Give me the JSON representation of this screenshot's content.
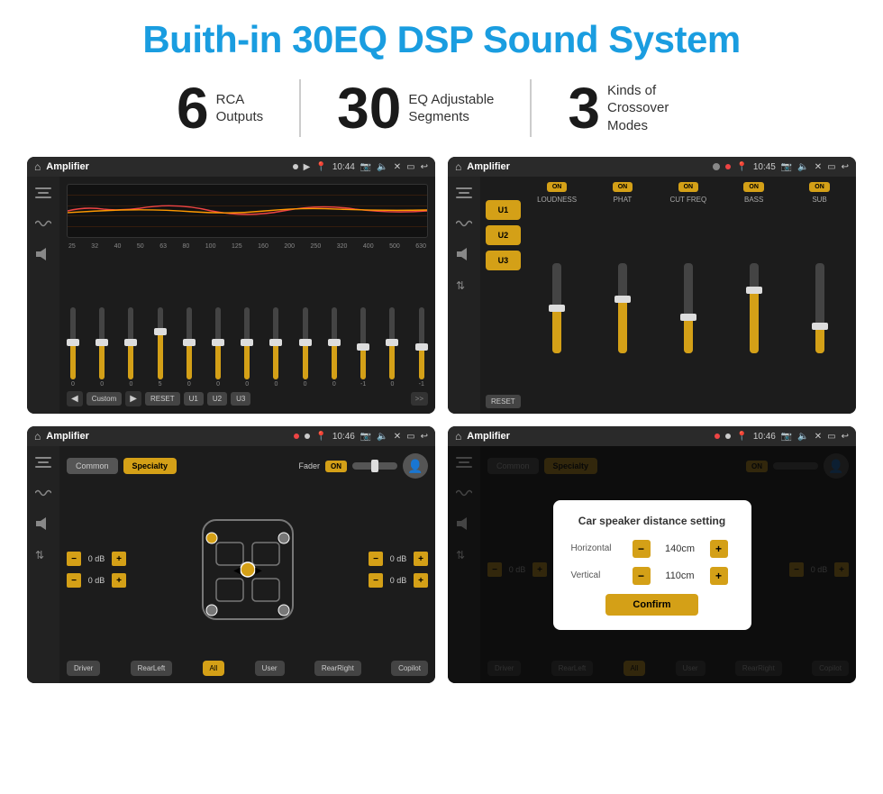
{
  "header": {
    "title": "Buith-in 30EQ DSP Sound System"
  },
  "stats": [
    {
      "number": "6",
      "text": "RCA\nOutputs"
    },
    {
      "number": "30",
      "text": "EQ Adjustable\nSegments"
    },
    {
      "number": "3",
      "text": "Kinds of\nCrossover Modes"
    }
  ],
  "screens": {
    "eq": {
      "statusBar": {
        "appName": "Amplifier",
        "time": "10:44"
      },
      "freqLabels": [
        "25",
        "32",
        "40",
        "50",
        "63",
        "80",
        "100",
        "125",
        "160",
        "200",
        "250",
        "320",
        "400",
        "500",
        "630"
      ],
      "sliderValues": [
        "0",
        "0",
        "0",
        "5",
        "0",
        "0",
        "0",
        "0",
        "0",
        "0",
        "-1",
        "0",
        "-1"
      ],
      "buttons": [
        "Custom",
        "RESET",
        "U1",
        "U2",
        "U3"
      ]
    },
    "crossover": {
      "statusBar": {
        "appName": "Amplifier",
        "time": "10:45"
      },
      "presets": [
        "U1",
        "U2",
        "U3"
      ],
      "channels": [
        {
          "label": "LOUDNESS",
          "on": true
        },
        {
          "label": "PHAT",
          "on": true
        },
        {
          "label": "CUT FREQ",
          "on": true
        },
        {
          "label": "BASS",
          "on": true
        },
        {
          "label": "SUB",
          "on": true
        }
      ],
      "resetBtn": "RESET"
    },
    "fader": {
      "statusBar": {
        "appName": "Amplifier",
        "time": "10:46"
      },
      "tabs": [
        "Common",
        "Specialty"
      ],
      "faderLabel": "Fader",
      "onBadge": "ON",
      "dbValues": [
        "0 dB",
        "0 dB",
        "0 dB",
        "0 dB"
      ],
      "bottomButtons": [
        "Driver",
        "RearLeft",
        "All",
        "User",
        "RearRight",
        "Copilot"
      ]
    },
    "distance": {
      "statusBar": {
        "appName": "Amplifier",
        "time": "10:46"
      },
      "tabs": [
        "Common",
        "Specialty"
      ],
      "onBadge": "ON",
      "dialog": {
        "title": "Car speaker distance setting",
        "horizontal": {
          "label": "Horizontal",
          "value": "140cm"
        },
        "vertical": {
          "label": "Vertical",
          "value": "110cm"
        },
        "confirmBtn": "Confirm"
      },
      "dbValues": [
        "0 dB",
        "0 dB"
      ],
      "bottomButtons": [
        "Driver",
        "RearLeft",
        "All",
        "User",
        "RearRight",
        "Copilot"
      ]
    }
  }
}
